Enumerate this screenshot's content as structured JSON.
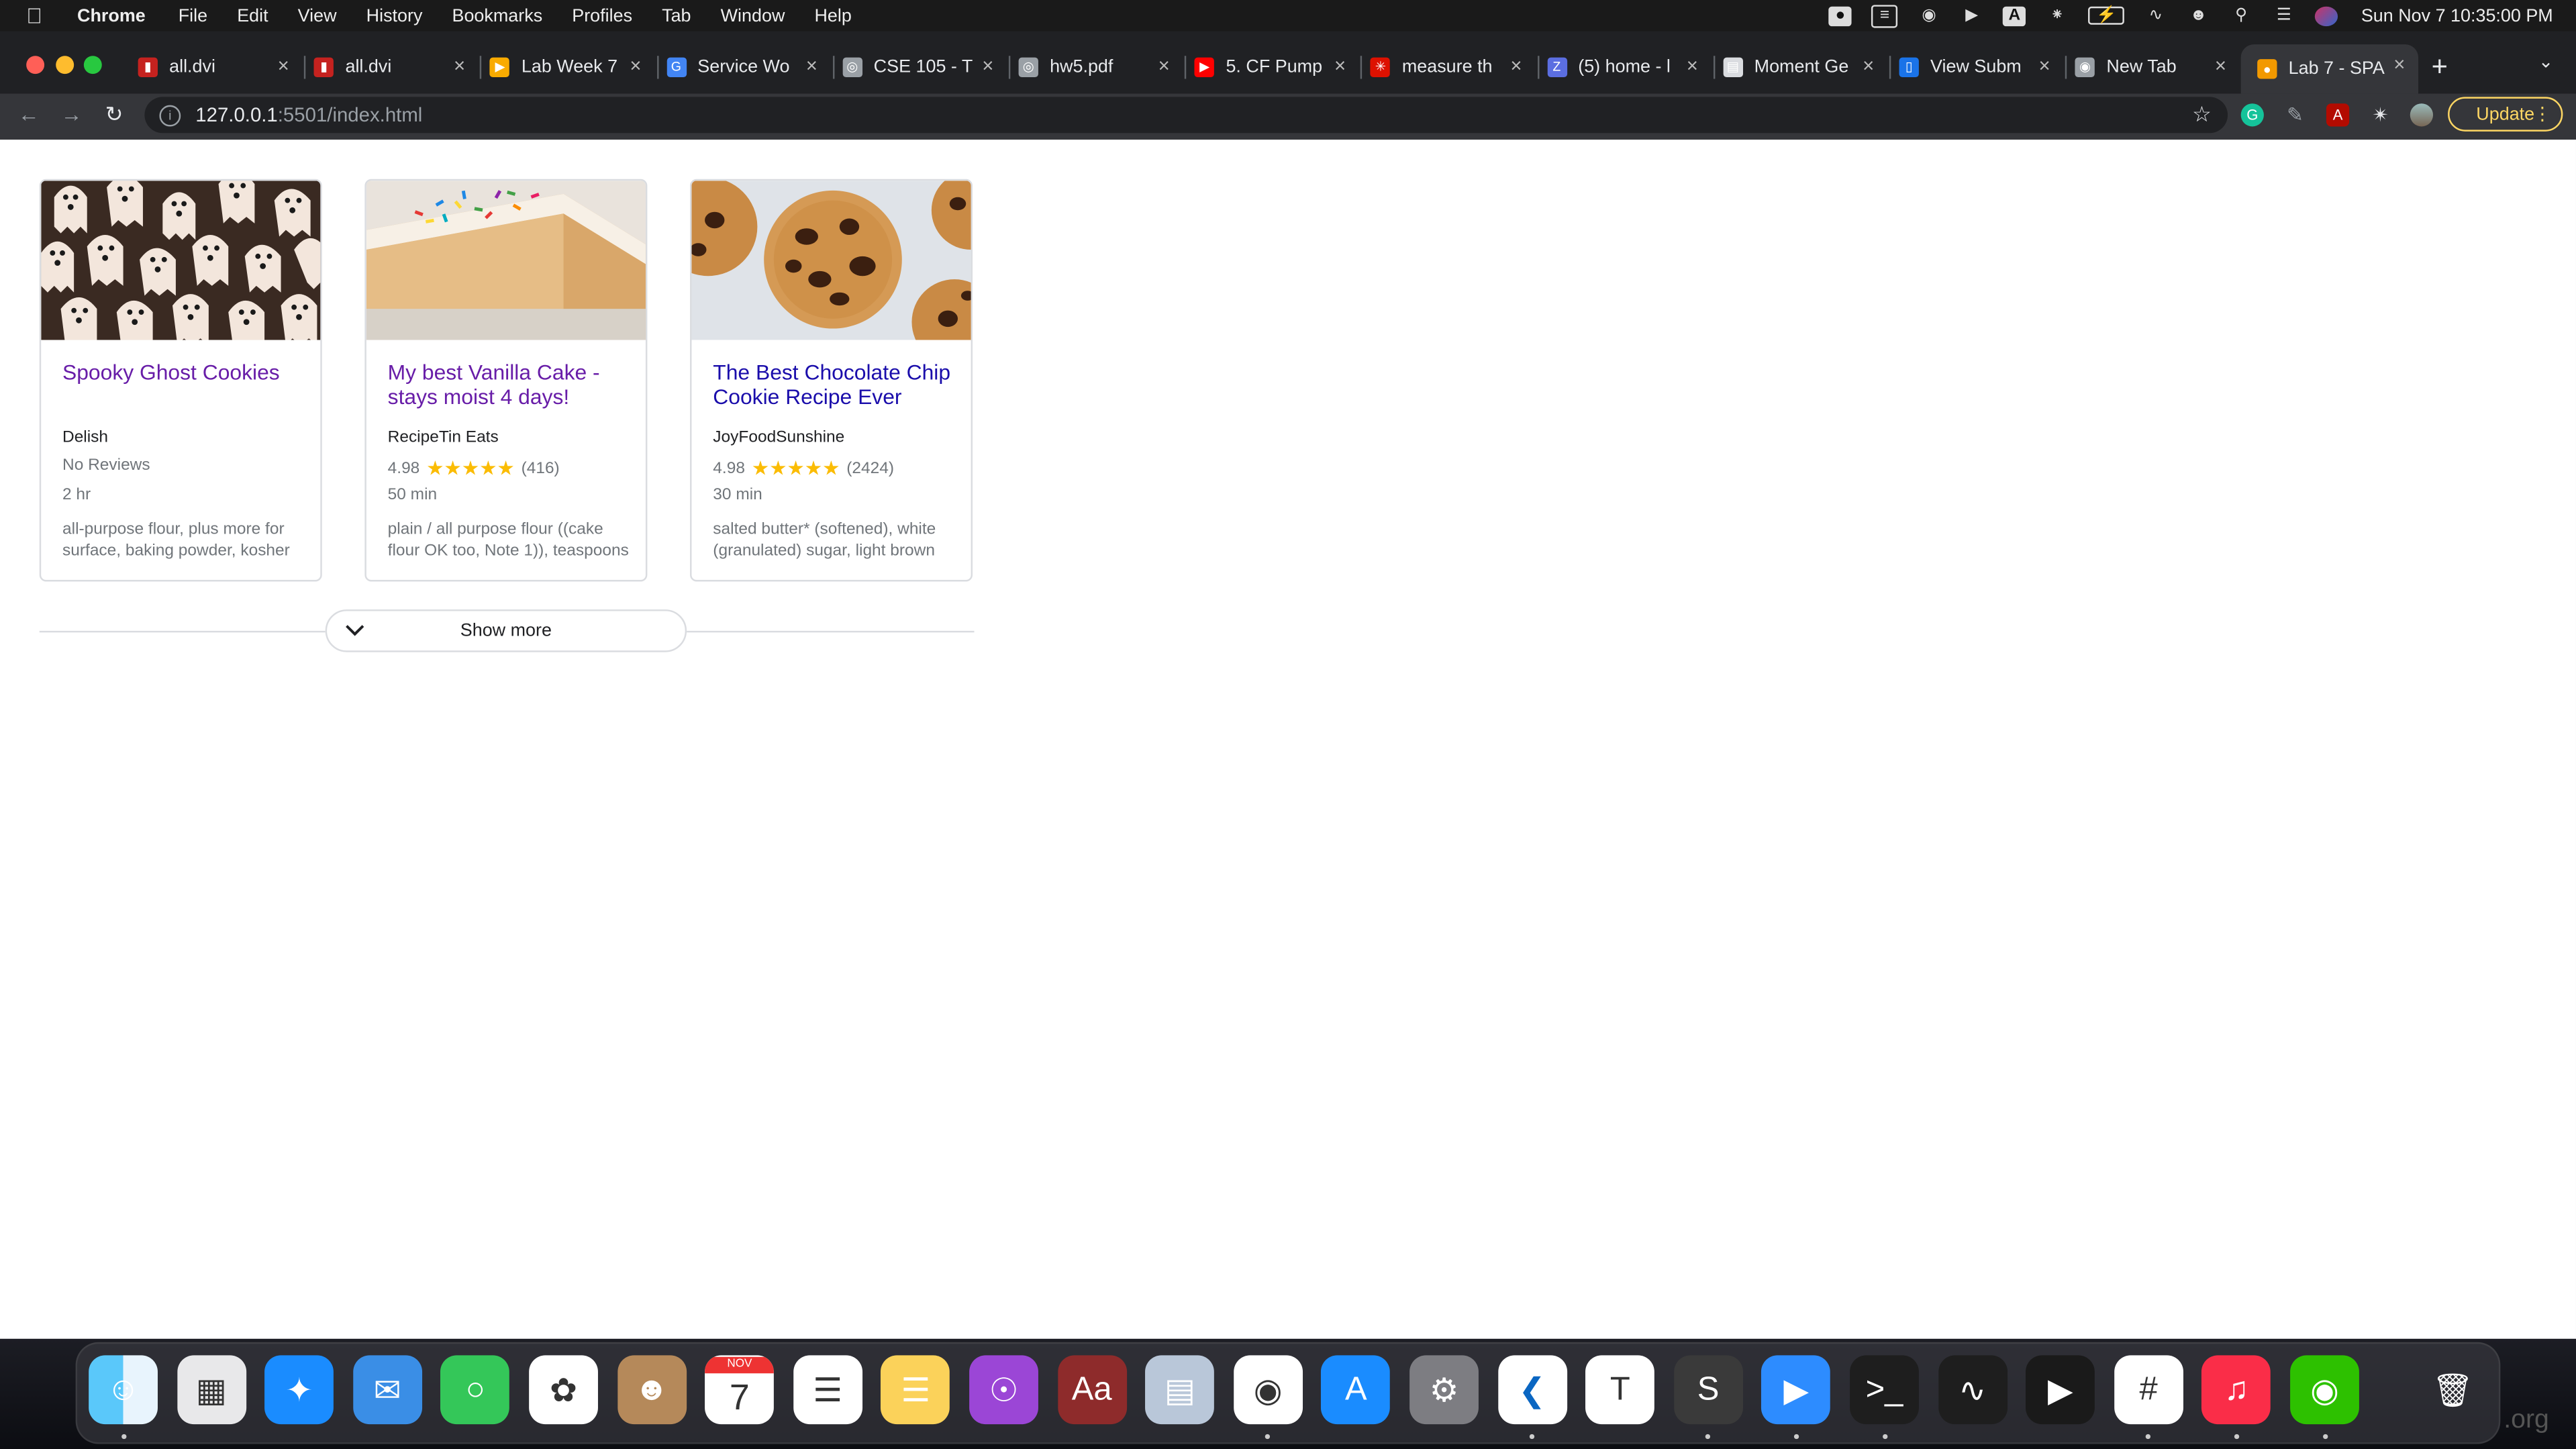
{
  "menubar": {
    "app": "Chrome",
    "menus": [
      "File",
      "Edit",
      "View",
      "History",
      "Bookmarks",
      "Profiles",
      "Tab",
      "Window",
      "Help"
    ],
    "clock": "Sun Nov 7  10:35:00 PM"
  },
  "browser": {
    "tabs": [
      {
        "title": "all.dvi",
        "favicon": "pdf-icon",
        "color": "#c5221f"
      },
      {
        "title": "all.dvi",
        "favicon": "pdf-icon",
        "color": "#c5221f"
      },
      {
        "title": "Lab Week 7",
        "favicon": "slides-icon",
        "color": "#f9ab00"
      },
      {
        "title": "Service Wo",
        "favicon": "google-icon",
        "color": "#4285f4"
      },
      {
        "title": "CSE 105 - T",
        "favicon": "globe-icon",
        "color": "#9aa0a6"
      },
      {
        "title": "hw5.pdf",
        "favicon": "globe-icon",
        "color": "#9aa0a6"
      },
      {
        "title": "5. CF Pump",
        "favicon": "youtube-icon",
        "color": "#ff0000"
      },
      {
        "title": "measure th",
        "favicon": "wolfram-icon",
        "color": "#dd1100"
      },
      {
        "title": "(5) home - l",
        "favicon": "zulip-icon",
        "color": "#5b6ee1"
      },
      {
        "title": "Moment Ge",
        "favicon": "doc-icon",
        "color": "#dadce0"
      },
      {
        "title": "View Subm",
        "favicon": "chart-icon",
        "color": "#1a73e8"
      },
      {
        "title": "New Tab",
        "favicon": "chrome-icon",
        "color": "#9aa0a6"
      },
      {
        "title": "Lab 7 - SPA",
        "favicon": "page-icon",
        "color": "#f29900"
      }
    ],
    "url_host": "127.0.0.1",
    "url_rest": ":5501/index.html",
    "update_label": "Update"
  },
  "recipes": [
    {
      "title": "Spooky Ghost Cookies",
      "source": "Delish",
      "rating": "",
      "stars": "",
      "reviews": "No Reviews",
      "time": "2 hr",
      "ingredients": "all-purpose flour, plus more for surface, baking powder, kosher"
    },
    {
      "title": "My best Vanilla Cake - stays moist 4 days!",
      "source": "RecipeTin Eats",
      "rating": "4.98",
      "stars": "★★★★★",
      "reviews": "(416)",
      "time": "50 min",
      "ingredients": "plain / all purpose flour ((cake flour OK too, Note 1)), teaspoons"
    },
    {
      "title": "The Best Chocolate Chip Cookie Recipe Ever",
      "source": "JoyFoodSunshine",
      "rating": "4.98",
      "stars": "★★★★★",
      "reviews": "(2424)",
      "time": "30 min",
      "ingredients": "salted butter* (softened), white (granulated) sugar, light brown"
    }
  ],
  "show_more": "Show more",
  "calendar": {
    "month": "NOV",
    "day": "7"
  },
  "dock": [
    "Finder",
    "Launchpad",
    "Safari",
    "Mail",
    "Messages",
    "Photos",
    "Contacts",
    "Calendar",
    "Reminders",
    "Notes",
    "Podcasts",
    "Dictionary",
    "Preview",
    "Chrome",
    "App Store",
    "System Preferences",
    "VS Code",
    "Typora",
    "Sublime Text",
    "Zoom",
    "Terminal",
    "Activity Monitor",
    "Infuse",
    "Slack",
    "Music",
    "WeChat",
    "Trash"
  ],
  "colors": {
    "link": "#1a0dab",
    "visited": "#681da8",
    "star": "#fbbc04",
    "update": "#fdd663"
  }
}
